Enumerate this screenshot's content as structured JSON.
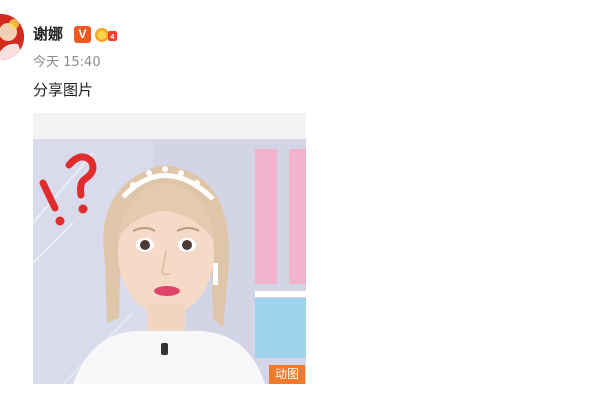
{
  "post": {
    "username": "谢娜",
    "verified_badge": "V",
    "time": "今天 15:40",
    "text": "分享图片",
    "image_badge": "动图"
  },
  "icons": {
    "avatar": "avatar-image",
    "verified": "verified-v-icon",
    "medal": "medal-icon"
  },
  "colors": {
    "verified_badge": "#f0581f",
    "gif_badge": "#f07a2e",
    "username": "#222222",
    "time": "#8a8a8a"
  }
}
